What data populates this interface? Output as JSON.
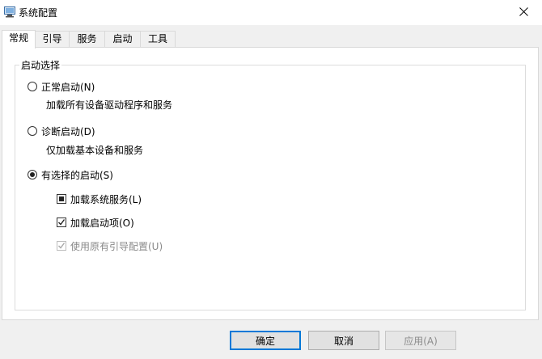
{
  "window": {
    "title": "系统配置"
  },
  "tabs": [
    {
      "label": "常规",
      "active": true
    },
    {
      "label": "引导",
      "active": false
    },
    {
      "label": "服务",
      "active": false
    },
    {
      "label": "启动",
      "active": false
    },
    {
      "label": "工具",
      "active": false
    }
  ],
  "startup": {
    "group_label": "启动选择",
    "normal": {
      "label": "正常启动(N)",
      "desc": "加载所有设备驱动程序和服务",
      "selected": false
    },
    "diagnostic": {
      "label": "诊断启动(D)",
      "desc": "仅加载基本设备和服务",
      "selected": false
    },
    "selective": {
      "label": "有选择的启动(S)",
      "selected": true
    },
    "options": [
      {
        "label": "加载系统服务(L)",
        "state": "indeterminate",
        "enabled": true
      },
      {
        "label": "加载启动项(O)",
        "state": "checked",
        "enabled": true
      },
      {
        "label": "使用原有引导配置(U)",
        "state": "checked",
        "enabled": false
      }
    ]
  },
  "buttons": {
    "ok": "确定",
    "cancel": "取消",
    "apply": "应用(A)"
  }
}
